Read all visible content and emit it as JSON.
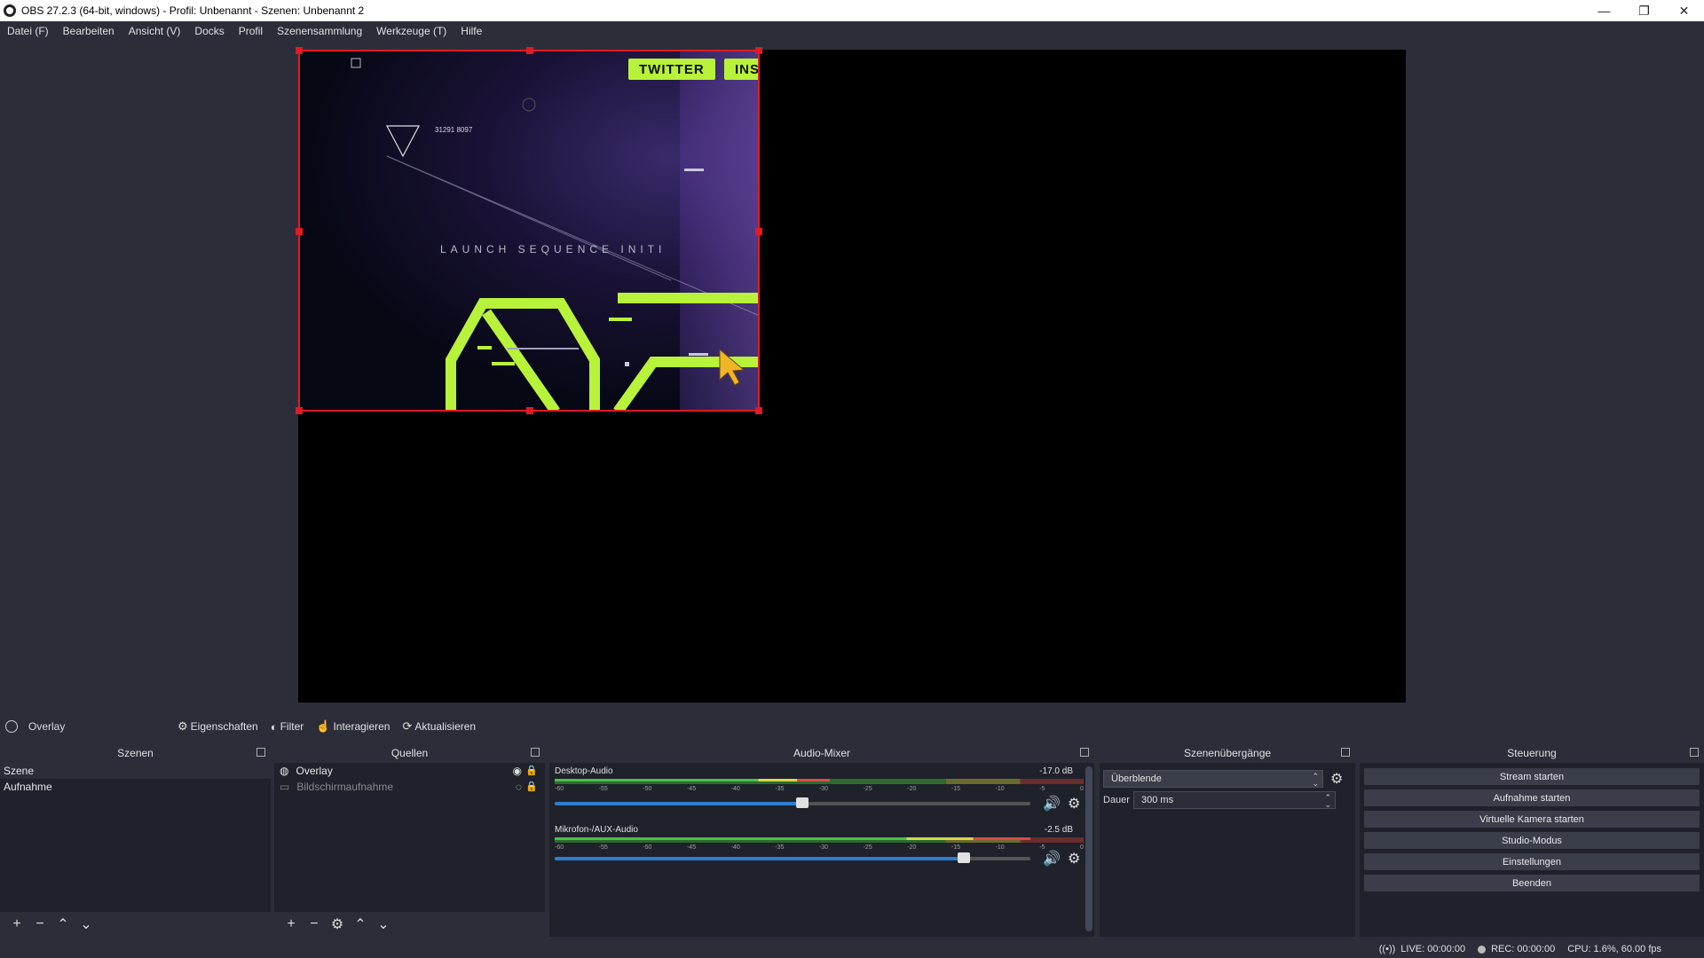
{
  "window": {
    "title": "OBS 27.2.3 (64-bit, windows) - Profil: Unbenannt - Szenen: Unbenannt 2",
    "minimize": "—",
    "maximize": "❐",
    "close": "✕"
  },
  "menu": [
    "Datei (F)",
    "Bearbeiten",
    "Ansicht (V)",
    "Docks",
    "Profil",
    "Szenensammlung",
    "Werkzeuge (T)",
    "Hilfe"
  ],
  "preview": {
    "tags": [
      "TWITTER",
      "INST"
    ],
    "launch_text": "LAUNCH SEQUENCE INITI",
    "coords_text": "31291 8097",
    "accent_color": "#b8f23a",
    "selection_color": "#e01b24"
  },
  "source_toolbar": {
    "current_source": "Overlay",
    "properties": "Eigenschaften",
    "filter": "Filter",
    "interact": "Interagieren",
    "refresh": "Aktualisieren"
  },
  "scenes": {
    "title": "Szenen",
    "items": [
      "Szene",
      "Aufnahme"
    ]
  },
  "sources": {
    "title": "Quellen",
    "items": [
      {
        "name": "Overlay",
        "visible": true,
        "icon": "globe-icon"
      },
      {
        "name": "Bildschirmaufnahme",
        "visible": false,
        "icon": "monitor-icon"
      }
    ]
  },
  "mixer": {
    "title": "Audio-Mixer",
    "tick_labels": [
      "-60",
      "-55",
      "-50",
      "-45",
      "-40",
      "-35",
      "-30",
      "-25",
      "-20",
      "-15",
      "-10",
      "-5",
      "0"
    ],
    "channels": [
      {
        "name": "Desktop-Audio",
        "db": "-17.0 dB",
        "level": 0.52,
        "volume": 0.52
      },
      {
        "name": "Mikrofon-/AUX-Audio",
        "db": "-2.5 dB",
        "level": 0.9,
        "volume": 0.86
      }
    ]
  },
  "transitions": {
    "title": "Szenenübergänge",
    "selected": "Überblende",
    "duration_label": "Dauer",
    "duration_value": "300 ms"
  },
  "controls": {
    "title": "Steuerung",
    "buttons": [
      "Stream starten",
      "Aufnahme starten",
      "Virtuelle Kamera starten",
      "Studio-Modus",
      "Einstellungen",
      "Beenden"
    ]
  },
  "status": {
    "live": "LIVE: 00:00:00",
    "rec": "REC: 00:00:00",
    "cpu": "CPU: 1.6%, 60.00 fps"
  }
}
